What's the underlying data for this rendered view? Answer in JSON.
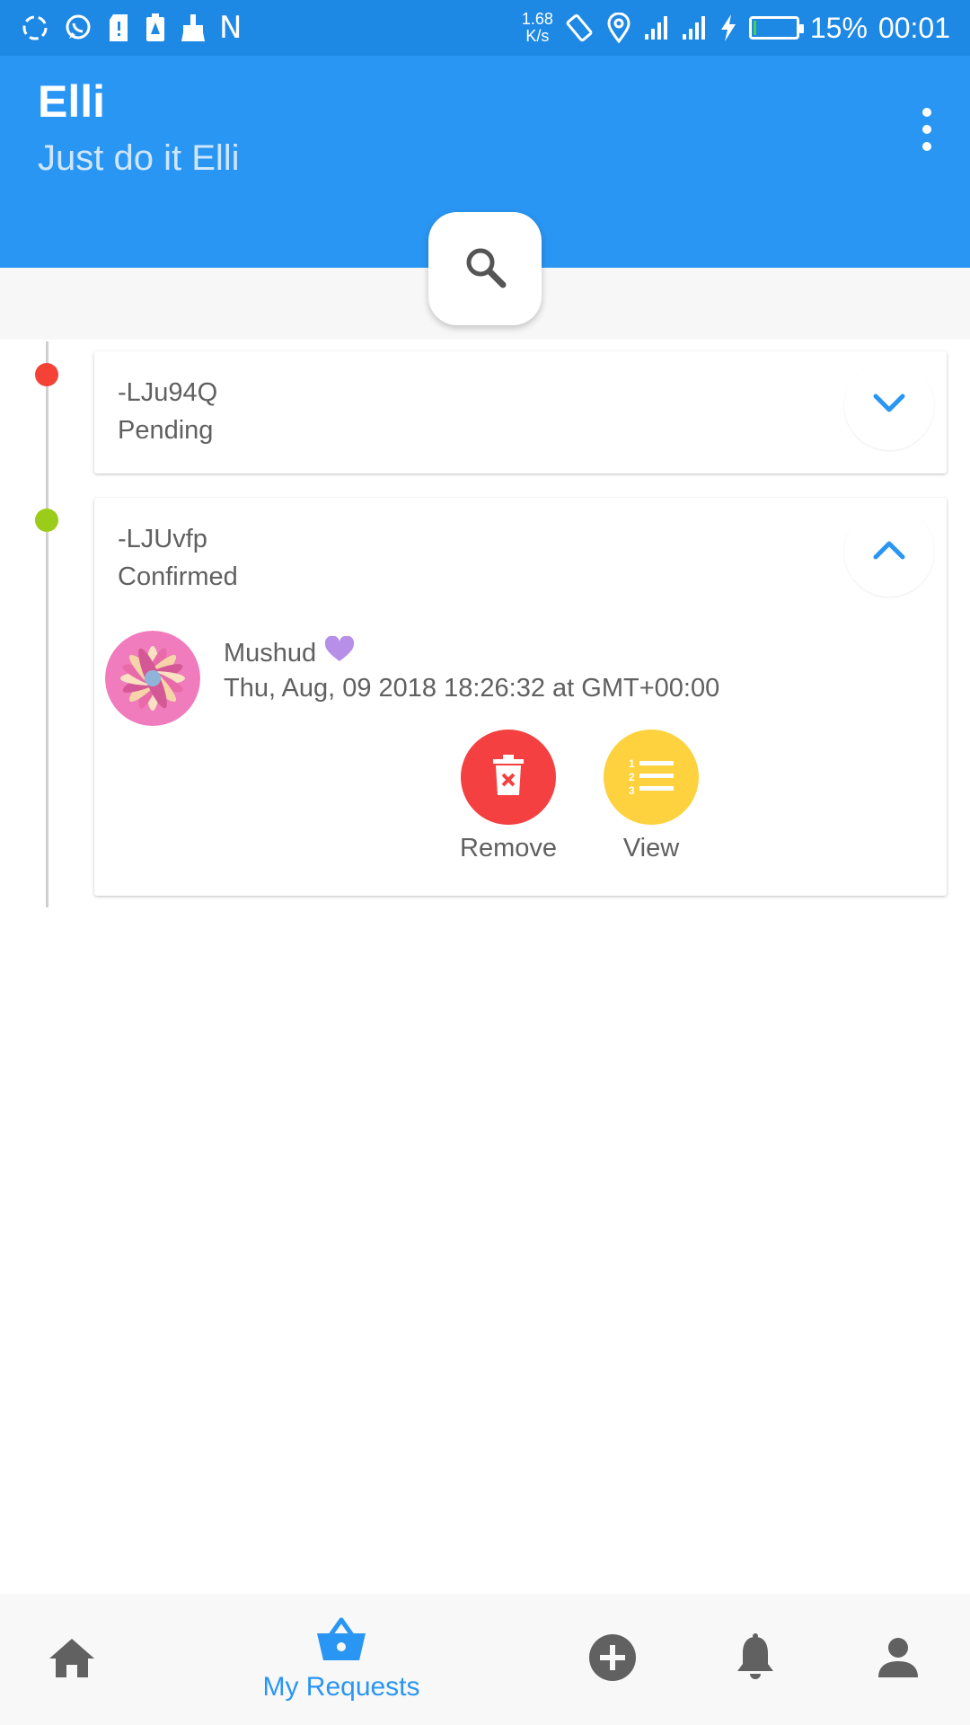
{
  "status_bar": {
    "left_icons": [
      "sync-icon",
      "whatsapp-icon",
      "sd-card-icon",
      "battery-alert-icon",
      "cleaner-icon"
    ],
    "n_label": "N",
    "speed_value": "1.68",
    "speed_unit": "K/s",
    "right_icons": [
      "rotate-icon",
      "location-icon",
      "signal-icon",
      "signal-3g-icon",
      "charging-icon"
    ],
    "battery_level": 15,
    "battery_text": "15%",
    "time": "00:01"
  },
  "app_bar": {
    "title": "Elli",
    "subtitle": "Just do it Elli",
    "menu_icon": "more-vert-icon",
    "color": "#2a96f3"
  },
  "search": {
    "icon": "search-icon"
  },
  "requests": [
    {
      "id": "-LJu94Q",
      "status": "Pending",
      "status_color": "#f44336",
      "expanded": false
    },
    {
      "id": "-LJUvfp",
      "status": "Confirmed",
      "status_color": "#9ccc1a",
      "expanded": true,
      "user_name": "Mushud",
      "datetime": "Thu, Aug, 09 2018 18:26:32 at GMT+00:00",
      "actions": [
        {
          "label": "Remove",
          "icon": "delete-icon",
          "color": "#f44040"
        },
        {
          "label": "View",
          "icon": "list-numbered-icon",
          "color": "#fdd23e"
        }
      ]
    }
  ],
  "bottom_nav": {
    "items": [
      {
        "icon": "home-icon"
      },
      {
        "icon": "basket-icon",
        "label": "My Requests",
        "active": true
      },
      {
        "icon": "add-circle-icon"
      },
      {
        "icon": "bell-icon"
      },
      {
        "icon": "person-icon"
      }
    ]
  }
}
